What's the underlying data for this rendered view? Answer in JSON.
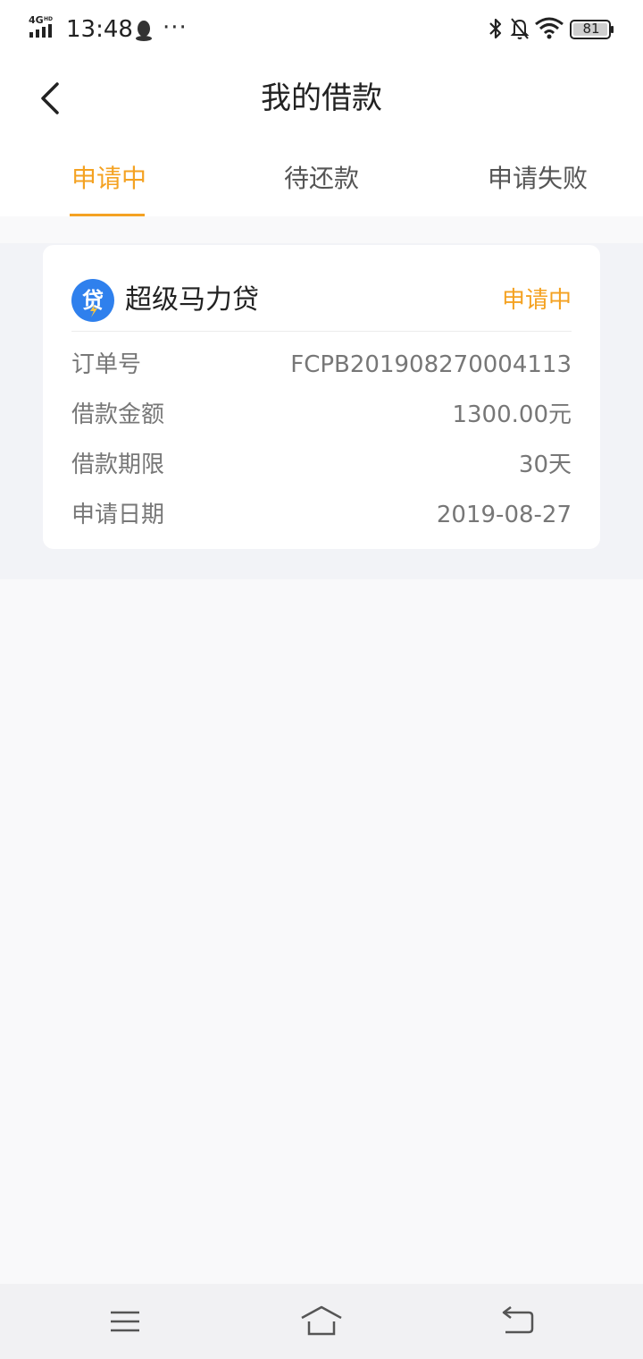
{
  "status_bar": {
    "network": "4GHD",
    "time": "13:48",
    "more": "···",
    "battery": "81"
  },
  "header": {
    "title": "我的借款"
  },
  "tabs": [
    {
      "label": "申请中",
      "active": true
    },
    {
      "label": "待还款",
      "active": false
    },
    {
      "label": "申请失败",
      "active": false
    }
  ],
  "colors": {
    "accent": "#f4a222",
    "logo_blue": "#2f80ed"
  },
  "loan_card": {
    "product_name": "超级马力贷",
    "status": "申请中",
    "rows": [
      {
        "label": "订单号",
        "value": "FCPB201908270004113"
      },
      {
        "label": "借款金额",
        "value": "1300.00元"
      },
      {
        "label": "借款期限",
        "value": "30天"
      },
      {
        "label": "申请日期",
        "value": "2019-08-27"
      }
    ]
  },
  "icons": {
    "back": "chevron-left-icon",
    "nav_menu": "menu-icon",
    "nav_home": "home-icon",
    "nav_back": "return-icon"
  }
}
